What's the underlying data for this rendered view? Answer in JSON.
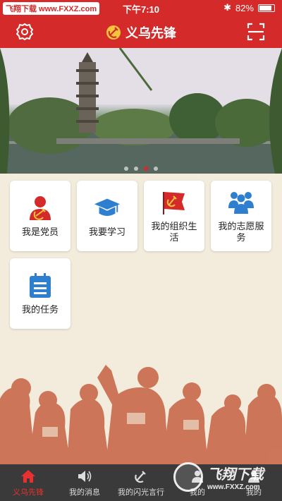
{
  "statusbar": {
    "site_tag": "飞翔下载 www.FXXZ.com",
    "time": "下午7:10",
    "battery": "82%"
  },
  "navbar": {
    "title": "义乌先锋",
    "settings_icon": "settings-icon",
    "scan_icon": "scan-icon"
  },
  "banner": {
    "pages": 4,
    "active_page": 3
  },
  "tiles": [
    {
      "label": "我是党员",
      "icon": "party-member-icon"
    },
    {
      "label": "我要学习",
      "icon": "graduation-cap-icon"
    },
    {
      "label": "我的组织生活",
      "icon": "party-flag-icon"
    },
    {
      "label": "我的志愿服务",
      "icon": "volunteers-icon"
    },
    {
      "label": "我的任务",
      "icon": "task-list-icon"
    }
  ],
  "tabbar": {
    "tabs": [
      {
        "label": "义乌先锋",
        "icon": "home-icon"
      },
      {
        "label": "我的消息",
        "icon": "speaker-icon"
      },
      {
        "label": "我的闪光言行",
        "icon": "party-emblem-icon"
      },
      {
        "label": "我的",
        "icon": "person-icon"
      },
      {
        "label": "我的",
        "icon": "person-icon"
      }
    ]
  },
  "watermark": {
    "name": "飞翔下载",
    "url": "www.FXXZ.com"
  },
  "colors": {
    "primary": "#d42a2a",
    "background": "#f3ecdc",
    "tile_icon_blue": "#2f7fcf",
    "tabbar": "#3a3a3a",
    "mural": "#c9694a"
  }
}
